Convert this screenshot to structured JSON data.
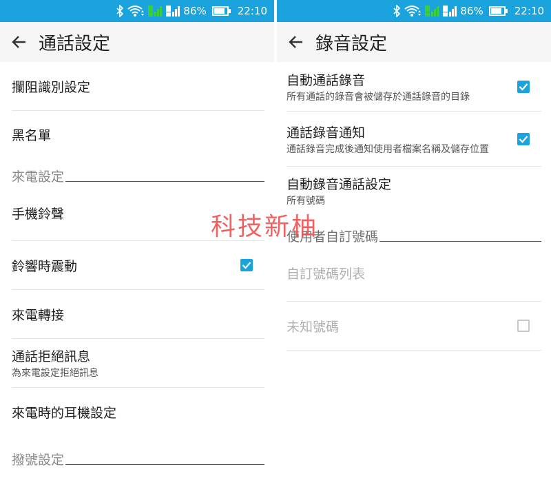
{
  "status_bar": {
    "battery_percent": "86%",
    "time": "22:10",
    "icons": [
      "bluetooth-icon",
      "wifi-icon",
      "sim1-signal-icon",
      "sim2-signal-icon",
      "battery-icon"
    ]
  },
  "colors": {
    "accent": "#1aa3dc",
    "watermark": "#f05050"
  },
  "left": {
    "title": "通話設定",
    "items": [
      {
        "title": "攔阻識別設定"
      },
      {
        "title": "黑名單"
      }
    ],
    "section_incoming": "來電設定",
    "incoming_items": [
      {
        "title": "手機鈴聲"
      },
      {
        "title": "鈴響時震動",
        "checked": true
      },
      {
        "title": "來電轉接"
      },
      {
        "title": "通話拒絕訊息",
        "subtitle": "為來電設定拒絕訊息"
      },
      {
        "title": "來電時的耳機設定"
      }
    ],
    "section_dial": "撥號設定"
  },
  "right": {
    "title": "錄音設定",
    "items": [
      {
        "title": "自動通話錄音",
        "subtitle": "所有通話的錄音會被儲存於通話錄音的目錄",
        "checked": true
      },
      {
        "title": "通話錄音通知",
        "subtitle": "通話錄音完成後通知使用者檔案名稱及儲存位置",
        "checked": true
      },
      {
        "title": "自動錄音通話設定",
        "subtitle": "所有號碼"
      }
    ],
    "section_custom": "使用者自訂號碼",
    "custom_items": [
      {
        "title": "自訂號碼列表",
        "enabled": false
      },
      {
        "title": "未知號碼",
        "enabled": false,
        "checked": false
      }
    ]
  },
  "watermark": "科技新柚"
}
